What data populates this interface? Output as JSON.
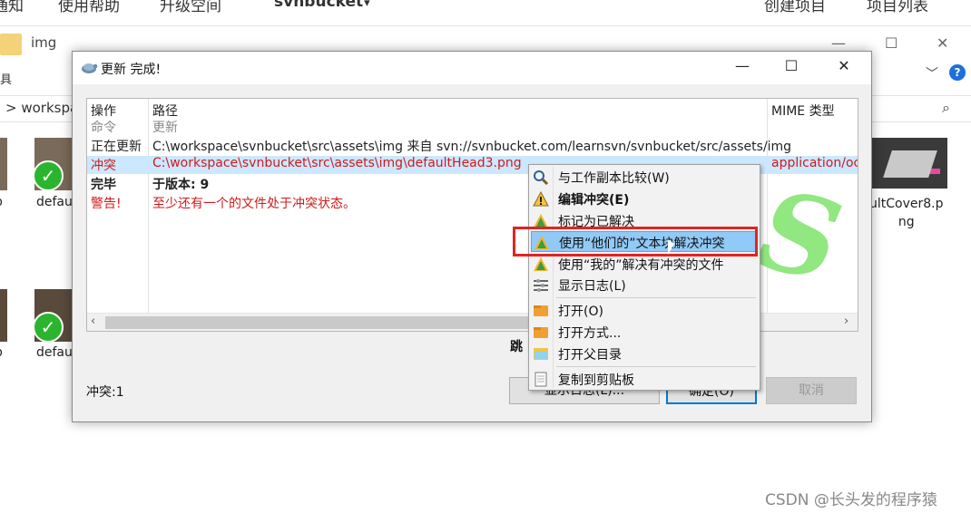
{
  "topbar": {
    "items": [
      "通知",
      "使用帮助",
      "升级空间",
      "svnbucket"
    ],
    "right": [
      "创建项目",
      "项目列表"
    ]
  },
  "explorer": {
    "title": "img",
    "ribbon_fragment": "具",
    "breadcrumb": "> workspace",
    "files": [
      {
        "name": "defau"
      },
      {
        "name": "defau"
      },
      {
        "name": "ultCover8.p\nng"
      }
    ],
    "left_fragments": [
      "p",
      "p"
    ]
  },
  "dialog": {
    "title": "更新 完成!",
    "columns": [
      "操作",
      "路径",
      "MIME 类型"
    ],
    "rows": [
      {
        "action": "命令",
        "path": "更新",
        "mime": "",
        "style": "grey"
      },
      {
        "action": "正在更新",
        "path": "C:\\workspace\\svnbucket\\src\\assets\\img 来自 svn://svnbucket.com/learnsvn/svnbucket/src/assets/img",
        "mime": "",
        "style": "normal"
      },
      {
        "action": "冲突",
        "path": "C:\\workspace\\svnbucket\\src\\assets\\img\\defaultHead3.png",
        "mime": "application/oct",
        "style": "conflict"
      },
      {
        "action": "完毕",
        "path": "于版本: 9",
        "mime": "",
        "style": "bold"
      },
      {
        "action": "警告!",
        "path": "至少还有一个的文件处于冲突状态。",
        "mime": "",
        "style": "red"
      }
    ],
    "skip_label": "跳",
    "conflicts_label": "冲突:1",
    "buttons": {
      "show_log": "显示日志(L)...",
      "ok": "确定(O)",
      "cancel": "取消"
    }
  },
  "context_menu": {
    "items": [
      {
        "label": "与工作副本比较(W)",
        "icon": "magnifier-icon",
        "bold": false
      },
      {
        "label": "编辑冲突(E)",
        "icon": "warning-icon",
        "bold": true
      },
      {
        "label": "标记为已解决",
        "icon": "resolve-icon",
        "bold": false
      },
      {
        "label": "使用“他们的”文本块解决冲突",
        "icon": "resolve-theirs-icon",
        "bold": false,
        "highlighted": true
      },
      {
        "label": "使用“我的”解决有冲突的文件",
        "icon": "resolve-mine-icon",
        "bold": false
      },
      {
        "label": "显示日志(L)",
        "icon": "log-icon",
        "bold": false
      },
      {
        "label": "打开(O)",
        "icon": "open-icon",
        "bold": false
      },
      {
        "label": "打开方式...",
        "icon": "open-with-icon",
        "bold": false
      },
      {
        "label": "打开父目录",
        "icon": "folder-icon",
        "bold": false
      },
      {
        "label": "复制到剪贴板",
        "icon": "clipboard-icon",
        "bold": false
      }
    ]
  },
  "watermark": "CSDN @长头发的程序猿",
  "colors": {
    "conflict_text": "#d01a1a",
    "selected_row": "#cce8ff",
    "menu_highlight": "#91c9f7",
    "annotation_box": "#e02424"
  }
}
